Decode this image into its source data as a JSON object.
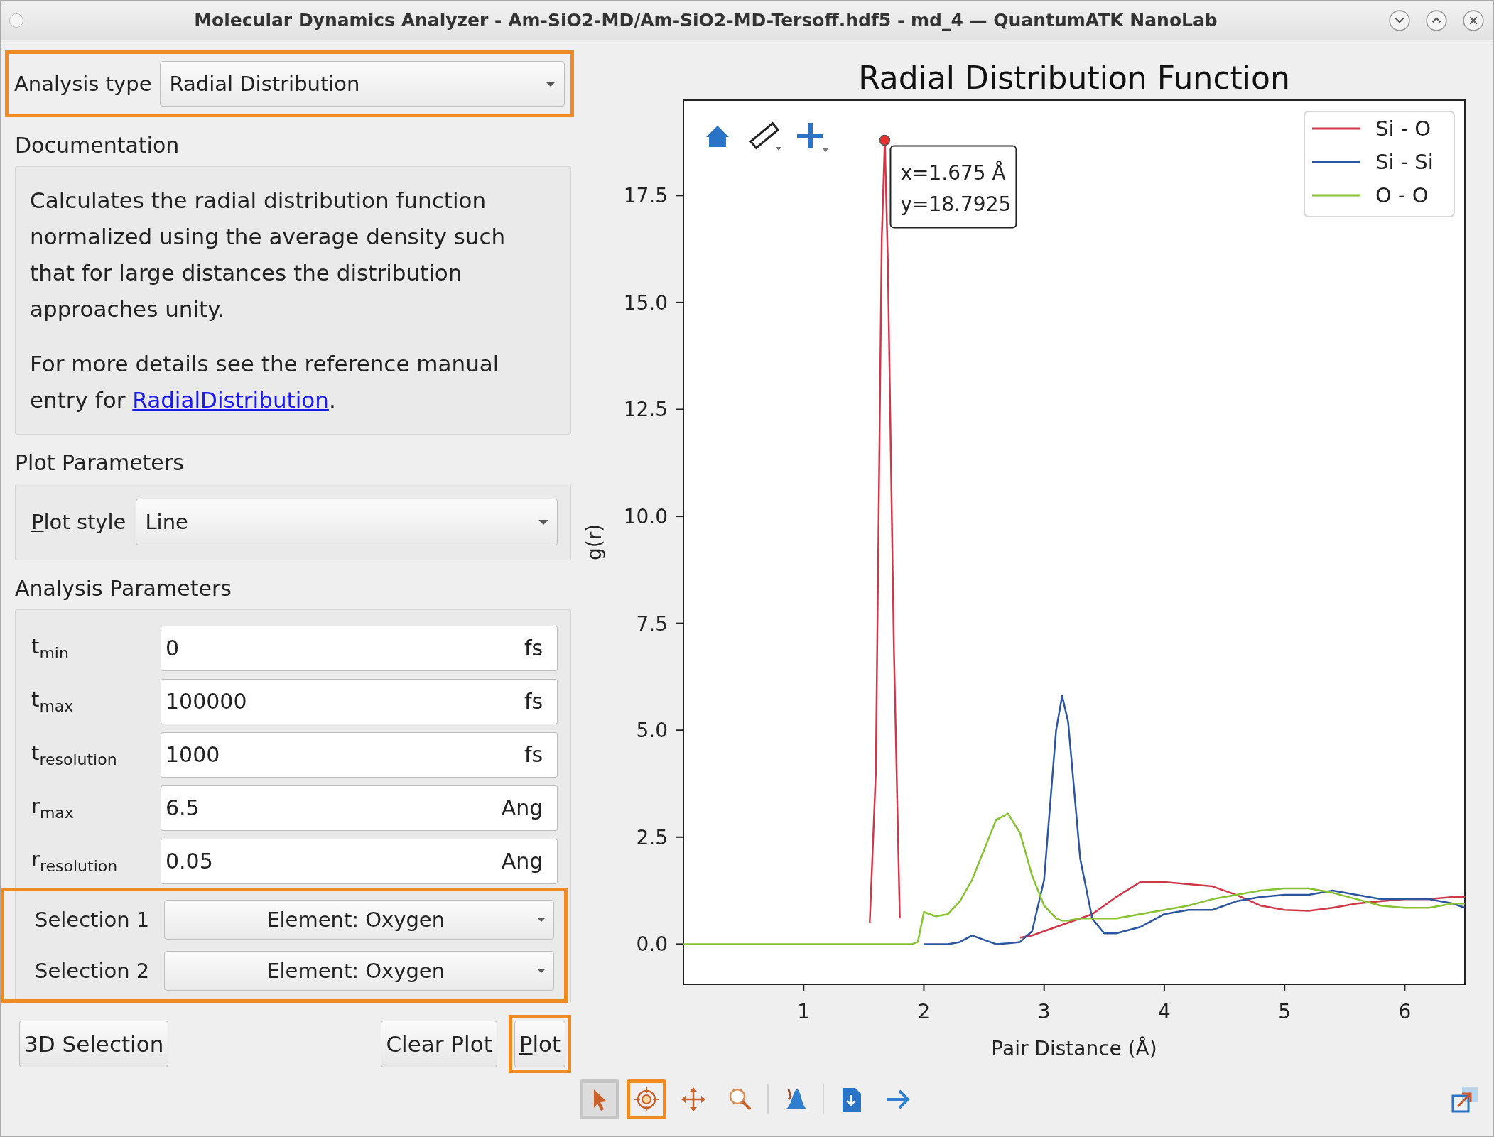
{
  "window": {
    "title": "Molecular Dynamics Analyzer - Am-SiO2-MD/Am-SiO2-MD-Tersoff.hdf5 - md_4 — QuantumATK NanoLab"
  },
  "analysis_type": {
    "label": "Analysis type",
    "value": "Radial Distribution",
    "highlighted": true
  },
  "documentation": {
    "heading": "Documentation",
    "paragraph": "Calculates the radial distribution function normalized using the average density such that for large distances the distribution approaches unity.",
    "more_text": "For more details see the reference manual entry for ",
    "link": "RadialDistribution",
    "after_link": "."
  },
  "plot_parameters": {
    "heading": "Plot Parameters",
    "label": "Plot style",
    "mnemonic_underline": true,
    "value": "Line"
  },
  "analysis_parameters": {
    "heading": "Analysis Parameters",
    "fields": [
      {
        "label": "t$_{min}$",
        "value": "0",
        "unit": "fs"
      },
      {
        "label": "t$_{max}$",
        "value": "100000",
        "unit": "fs"
      },
      {
        "label": "t$_{resolution}$",
        "value": "1000",
        "unit": "fs"
      },
      {
        "label": "r$_{max}$",
        "value": "6.5",
        "unit": "Ang"
      },
      {
        "label": "r$_{resolution}$",
        "value": "0.05",
        "unit": "Ang"
      }
    ],
    "selections_highlighted": true,
    "selections": [
      {
        "label": "Selection 1",
        "value": "Element: Oxygen"
      },
      {
        "label": "Selection 2",
        "value": "Element: Oxygen"
      }
    ]
  },
  "buttons": [
    {
      "label": "3D Selection",
      "mnemonic_underline": false,
      "highlighted": false
    },
    {
      "label": "Clear Plot",
      "mnemonic_underline": false,
      "highlighted": false
    },
    {
      "label": "Plot",
      "mnemonic_underline": true,
      "highlighted": true
    }
  ],
  "plot": {
    "chart_data": {
      "type": "line",
      "title": "Radial Distribution Function",
      "xlabel": "Pair Distance (Å)",
      "ylabel": "g(r)",
      "x": [
        0,
        0.5,
        1.0,
        1.5,
        1.55,
        1.6,
        1.65,
        1.675,
        1.7,
        1.75,
        1.8,
        1.9,
        1.95,
        2.0,
        2.1,
        2.2,
        2.3,
        2.4,
        2.5,
        2.6,
        2.7,
        2.8,
        2.9,
        3.0,
        3.1,
        3.15,
        3.2,
        3.3,
        3.4,
        3.5,
        3.6,
        3.8,
        4.0,
        4.2,
        4.4,
        4.6,
        4.8,
        5.0,
        5.2,
        5.4,
        5.6,
        5.8,
        6.0,
        6.2,
        6.4,
        6.5
      ],
      "series": [
        {
          "name": "Si - O",
          "color": "#d0384a",
          "values": [
            null,
            null,
            null,
            null,
            0.5,
            4.0,
            16.5,
            18.79,
            16,
            7,
            0.6,
            null,
            null,
            null,
            null,
            null,
            null,
            null,
            null,
            null,
            null,
            0.15,
            0.2,
            0.3,
            0.4,
            0.45,
            0.5,
            0.6,
            0.7,
            0.9,
            1.1,
            1.45,
            1.45,
            1.4,
            1.35,
            1.15,
            0.9,
            0.8,
            0.78,
            0.85,
            0.95,
            1.0,
            1.05,
            1.05,
            1.1,
            1.1
          ]
        },
        {
          "name": "Si - Si",
          "color": "#2c56a0",
          "values": [
            null,
            null,
            null,
            null,
            null,
            null,
            null,
            null,
            null,
            null,
            null,
            null,
            null,
            0,
            0,
            0,
            0.05,
            0.2,
            0.1,
            0,
            0.02,
            0.05,
            0.3,
            1.5,
            5.0,
            5.8,
            5.2,
            2.0,
            0.6,
            0.25,
            0.25,
            0.4,
            0.7,
            0.8,
            0.8,
            1.0,
            1.1,
            1.15,
            1.15,
            1.25,
            1.15,
            1.05,
            1.05,
            1.05,
            0.95,
            0.85
          ]
        },
        {
          "name": "O - O",
          "color": "#86c232",
          "values": [
            0,
            0,
            0,
            0,
            0,
            0,
            0,
            0,
            0,
            0,
            0,
            0,
            0.05,
            0.75,
            0.65,
            0.7,
            1.0,
            1.5,
            2.2,
            2.9,
            3.05,
            2.6,
            1.6,
            0.9,
            0.6,
            0.55,
            0.55,
            0.6,
            0.6,
            0.6,
            0.6,
            0.7,
            0.8,
            0.9,
            1.05,
            1.15,
            1.25,
            1.3,
            1.3,
            1.2,
            1.05,
            0.9,
            0.85,
            0.85,
            0.95,
            0.95
          ]
        }
      ],
      "xlim": [
        0,
        6.5
      ],
      "ylim": [
        -0.94,
        19.73
      ],
      "xticks": [
        1,
        2,
        3,
        4,
        5,
        6
      ],
      "yticks": [
        {
          "value": 0,
          "label": "0.0"
        },
        {
          "value": 2.5,
          "label": "2.5"
        },
        {
          "value": 5,
          "label": "5.0"
        },
        {
          "value": 7.5,
          "label": "7.5"
        },
        {
          "value": 10,
          "label": "10.0"
        },
        {
          "value": 12.5,
          "label": "12.5"
        },
        {
          "value": 15,
          "label": "15.0"
        },
        {
          "value": 17.5,
          "label": "17.5"
        }
      ],
      "legend": true,
      "annotations": [
        {
          "x": 1.675,
          "y": 18.79,
          "text": "x=1.675 Å\ny=18.7925"
        }
      ]
    },
    "overlay_tools": [
      {
        "kind": "home"
      },
      {
        "kind": "ruler"
      },
      {
        "kind": "plus"
      }
    ]
  },
  "toolbar": [
    {
      "kind": "pointer",
      "selected": true,
      "highlighted": false
    },
    {
      "kind": "crosshair",
      "selected": false,
      "highlighted": true
    },
    {
      "kind": "move",
      "selected": false,
      "highlighted": false
    },
    {
      "kind": "zoom",
      "selected": false,
      "highlighted": false
    },
    {
      "kind": "separator"
    },
    {
      "kind": "peak",
      "selected": false,
      "highlighted": false
    },
    {
      "kind": "separator"
    },
    {
      "kind": "export",
      "selected": false,
      "highlighted": false
    },
    {
      "kind": "forward",
      "selected": false,
      "highlighted": false
    }
  ]
}
